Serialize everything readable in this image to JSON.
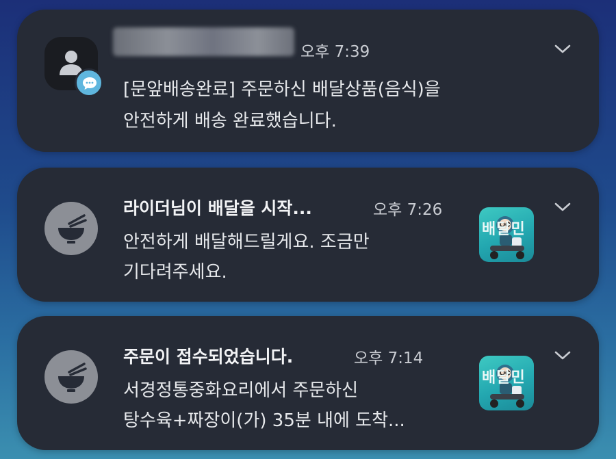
{
  "notifications": [
    {
      "time": "오후 7:39",
      "body_line1": "[문앞배송완료] 주문하신 배달상품(음식)을",
      "body_line2": "안전하게 배송 완료했습니다.",
      "icon": "person-icon",
      "badge_icon": "message-icon"
    },
    {
      "title": "라이더님이 배달을 시작...",
      "time": "오후 7:26",
      "body_line1": "안전하게 배달해드릴게요. 조금만",
      "body_line2": "기다려주세요.",
      "icon": "bowl-chopsticks-icon",
      "thumbnail_text": "배달민"
    },
    {
      "title": "주문이 접수되었습니다.",
      "time": "오후 7:14",
      "body_line1": "서경정통중화요리에서 주문하신",
      "body_line2": "탕수육+짜장이(가) 35분 내에 도착...",
      "icon": "bowl-chopsticks-icon",
      "thumbnail_text": "배달민"
    }
  ],
  "colors": {
    "card_bg": "#262b36",
    "accent_badge": "#5fb6de",
    "thumbnail_teal": "#2bb3b6"
  }
}
